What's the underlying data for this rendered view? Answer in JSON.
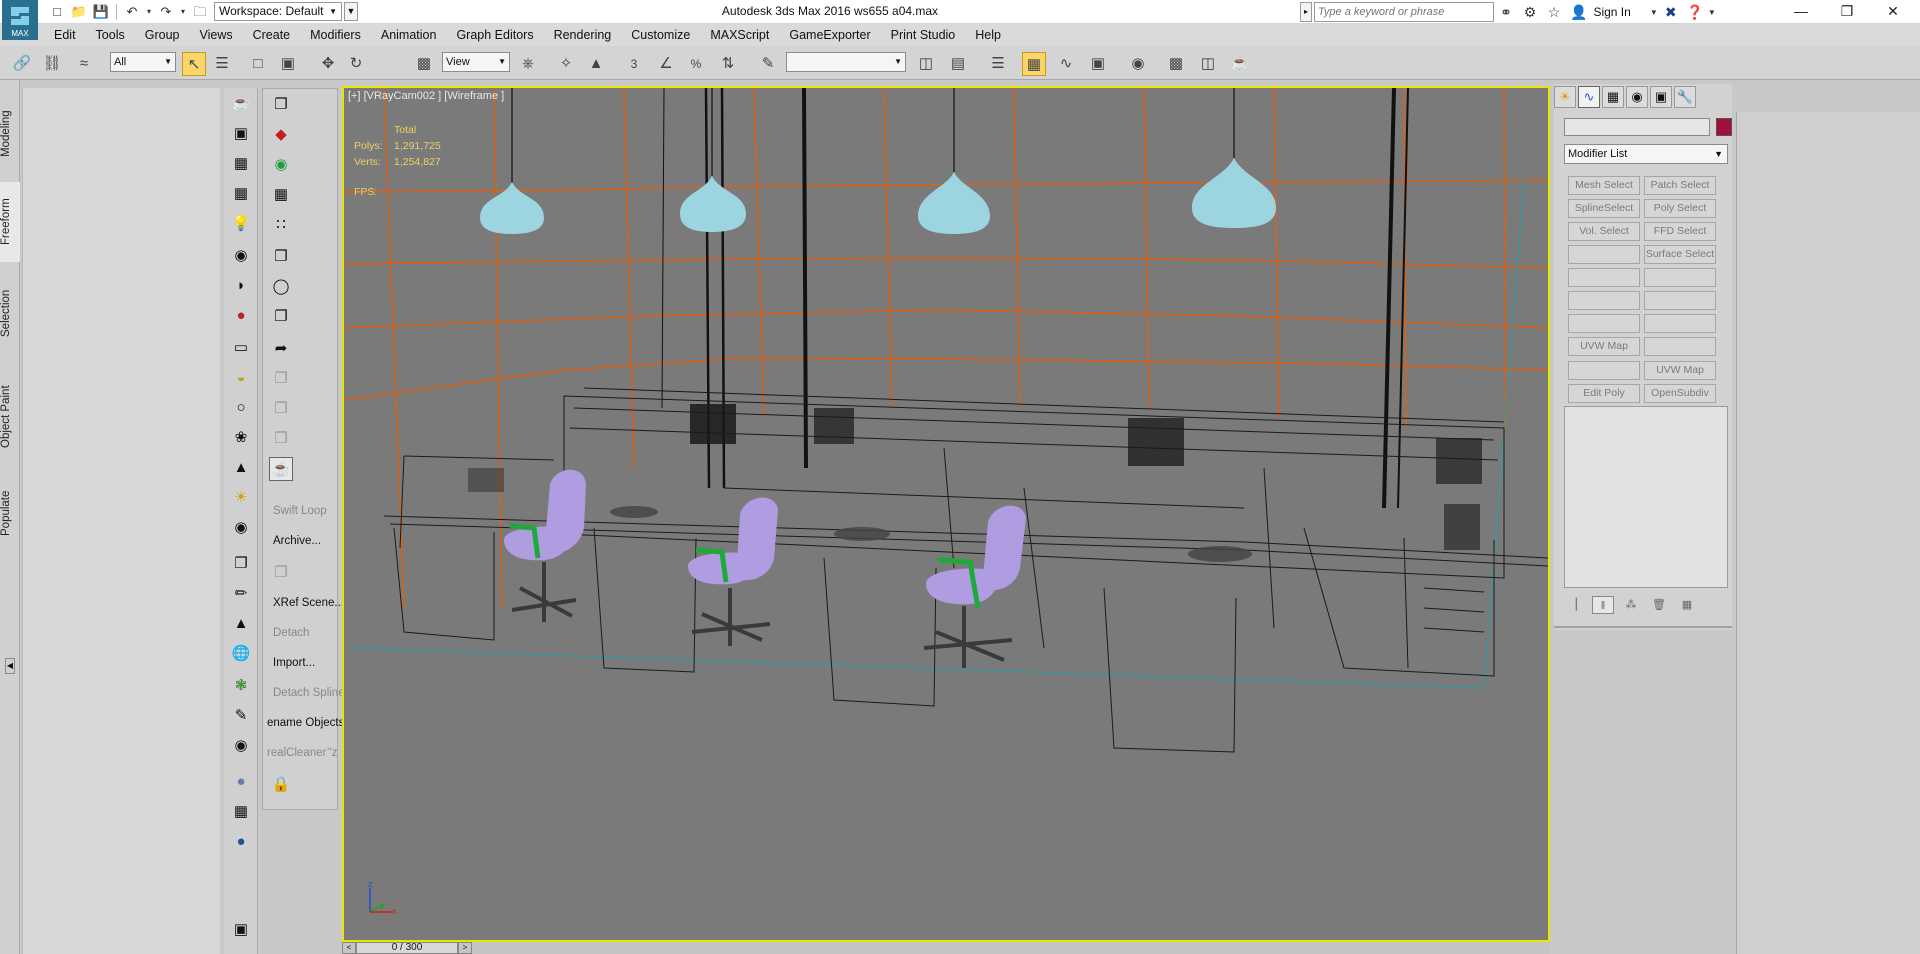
{
  "app": {
    "logo_label": "MAX",
    "window_title": "Autodesk 3ds Max 2016      ws655 a04.max",
    "workspace": "Workspace: Default"
  },
  "search": {
    "placeholder": "Type a keyword or phrase",
    "sign_in": "Sign In"
  },
  "menu": [
    "Edit",
    "Tools",
    "Group",
    "Views",
    "Create",
    "Modifiers",
    "Animation",
    "Graph Editors",
    "Rendering",
    "Customize",
    "MAXScript",
    "GameExporter",
    "Print Studio",
    "Help"
  ],
  "toolbar": {
    "selection_filter": "All",
    "ref_coord": "View",
    "named_selection": ""
  },
  "ribbon_tabs": [
    "Modeling",
    "Freeform",
    "Selection",
    "Object Paint",
    "Populate"
  ],
  "ribbon_active": "Freeform",
  "command_list": {
    "swift_loop": "Swift Loop",
    "archive": "Archive...",
    "xref_scene": "XRef Scene...",
    "detach": "Detach",
    "import": "Import...",
    "detach_spline": "Detach Spline",
    "rename_objects": "ename Objects",
    "real_cleaner": "realCleaner’’z"
  },
  "viewport": {
    "label": "[+] [VRayCam002 ] [Wireframe ]",
    "stats": {
      "header": "Total",
      "polys_label": "Polys:",
      "polys": "1,291,725",
      "verts_label": "Verts:",
      "verts": "1,254,827"
    },
    "fps_label": "FPS:"
  },
  "timeslider": {
    "label": "0 / 300"
  },
  "command_panel": {
    "modifier_list": "Modifier List",
    "object_color": "#a0103a",
    "modifier_buttons": [
      [
        "Mesh Select",
        "Patch Select"
      ],
      [
        "SplineSelect",
        "Poly Select"
      ],
      [
        "Vol. Select",
        "FFD Select"
      ],
      [
        "",
        "Surface Select"
      ],
      [
        "",
        ""
      ],
      [
        "",
        ""
      ],
      [
        "",
        ""
      ],
      [
        "UVW Map",
        ""
      ],
      [
        "",
        "UVW Map"
      ],
      [
        "Edit Poly",
        "OpenSubdiv"
      ]
    ]
  },
  "colors": {
    "viewport_bg": "#7a7a7a",
    "active_border": "#e6e600",
    "chair_seat": "#b09ce0",
    "chair_arm": "#1eaa3a",
    "lamp": "#9cd4e0",
    "room_lines": "#e06010"
  }
}
